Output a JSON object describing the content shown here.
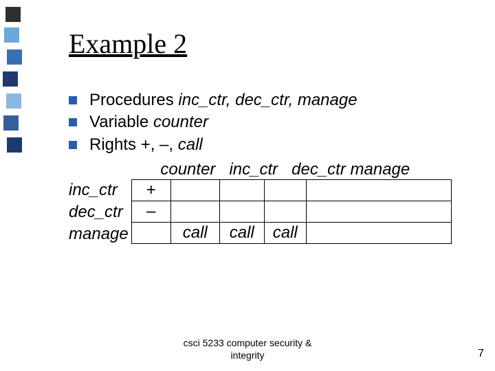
{
  "title": "Example 2",
  "bullets": [
    {
      "prefix": "Procedures ",
      "italic": "inc_ctr, dec_ctr, manage",
      "suffix": ""
    },
    {
      "prefix": "Variable ",
      "italic": "counter",
      "suffix": ""
    },
    {
      "prefix": "Rights ",
      "tail_html": "+, –, <span class=\"italic\">call</span>"
    }
  ],
  "table": {
    "col_headers": [
      "counter",
      "inc_ctr",
      "dec_ctr",
      "manage"
    ],
    "row_labels": [
      "inc_ctr",
      "dec_ctr",
      "manage"
    ],
    "cells": [
      [
        "+",
        "",
        "",
        "",
        ""
      ],
      [
        "–",
        "",
        "",
        "",
        ""
      ],
      [
        "",
        "call",
        "call",
        "call",
        ""
      ]
    ]
  },
  "footer_line1": "csci 5233 computer security &",
  "footer_line2": "integrity",
  "page_number": "7",
  "colors": {
    "stripe_colors": [
      "#2f2f2f",
      "#6aa9d8",
      "#3b6fb0",
      "#203a70",
      "#8ab8e0",
      "#355f98",
      "#1d3a6e"
    ]
  }
}
